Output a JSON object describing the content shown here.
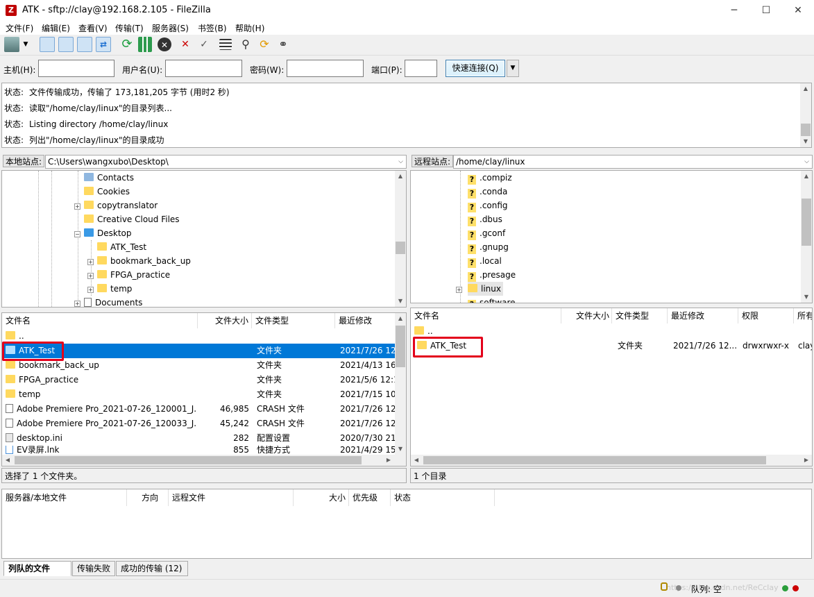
{
  "window": {
    "title": "ATK - sftp://clay@192.168.2.105 - FileZilla",
    "app_icon": "Z",
    "controls": [
      "─",
      "☐",
      "✕"
    ]
  },
  "menu": [
    "文件(F)",
    "编辑(E)",
    "查看(V)",
    "传输(T)",
    "服务器(S)",
    "书签(B)",
    "帮助(H)"
  ],
  "toolbar_icons": [
    "site-manager-icon",
    "dropdown-icon",
    "toggle-log-icon",
    "toggle-local-tree-icon",
    "toggle-remote-tree-icon",
    "toggle-queue-icon",
    "refresh-icon",
    "process-queue-icon",
    "cancel-icon",
    "disconnect-icon",
    "reconnect-icon",
    "filter-icon",
    "compare-icon",
    "sync-browse-icon",
    "search-icon"
  ],
  "quickconnect": {
    "host_label": "主机(H):",
    "user_label": "用户名(U):",
    "pass_label": "密码(W):",
    "port_label": "端口(P):",
    "host": "",
    "user": "",
    "pass": "",
    "port": "",
    "button": "快速连接(Q)",
    "dropdown": "▼"
  },
  "log": [
    {
      "k": "状态:",
      "v": "文件传输成功，传输了 173,181,205 字节 (用时2 秒)"
    },
    {
      "k": "状态:",
      "v": "读取\"/home/clay/linux\"的目录列表..."
    },
    {
      "k": "状态:",
      "v": "Listing directory /home/clay/linux"
    },
    {
      "k": "状态:",
      "v": "列出\"/home/clay/linux\"的目录成功"
    }
  ],
  "local": {
    "site_label": "本地站点:",
    "path": "C:\\Users\\wangxubo\\Desktop\\",
    "tree": [
      "Contacts",
      "Cookies",
      "copytranslator",
      "Creative Cloud Files",
      "Desktop",
      "ATK_Test",
      "bookmark_back_up",
      "FPGA_practice",
      "temp",
      "Documents"
    ],
    "headers": [
      "文件名",
      "文件大小",
      "文件类型",
      "最近修改"
    ],
    "files": [
      {
        "name": "..",
        "size": "",
        "type": "",
        "date": ""
      },
      {
        "name": "ATK_Test",
        "size": "",
        "type": "文件夹",
        "date": "2021/7/26 12"
      },
      {
        "name": "bookmark_back_up",
        "size": "",
        "type": "文件夹",
        "date": "2021/4/13 16"
      },
      {
        "name": "FPGA_practice",
        "size": "",
        "type": "文件夹",
        "date": "2021/5/6 12:1"
      },
      {
        "name": "temp",
        "size": "",
        "type": "文件夹",
        "date": "2021/7/15 10"
      },
      {
        "name": "Adobe Premiere Pro_2021-07-26_120001_J...",
        "size": "46,985",
        "type": "CRASH 文件",
        "date": "2021/7/26 12"
      },
      {
        "name": "Adobe Premiere Pro_2021-07-26_120033_J...",
        "size": "45,242",
        "type": "CRASH 文件",
        "date": "2021/7/26 12"
      },
      {
        "name": "desktop.ini",
        "size": "282",
        "type": "配置设置",
        "date": "2020/7/30 21"
      },
      {
        "name": "EV录屏.lnk",
        "size": "855",
        "type": "快捷方式",
        "date": "2021/4/29 15"
      }
    ],
    "status": "选择了 1 个文件夹。"
  },
  "remote": {
    "site_label": "远程站点:",
    "path": "/home/clay/linux",
    "tree": [
      ".compiz",
      ".conda",
      ".config",
      ".dbus",
      ".gconf",
      ".gnupg",
      ".local",
      ".presage",
      "linux",
      "software"
    ],
    "headers": [
      "文件名",
      "文件大小",
      "文件类型",
      "最近修改",
      "权限",
      "所有"
    ],
    "files": [
      {
        "name": "..",
        "size": "",
        "type": "",
        "date": "",
        "perm": "",
        "owner": ""
      },
      {
        "name": "ATK_Test",
        "size": "",
        "type": "文件夹",
        "date": "2021/7/26 12...",
        "perm": "drwxrwxr-x",
        "owner": "clay"
      }
    ],
    "status": "1 个目录"
  },
  "queue": {
    "headers": [
      "服务器/本地文件",
      "方向",
      "远程文件",
      "大小",
      "优先级",
      "状态"
    ]
  },
  "tabs": [
    "列队的文件",
    "传输失败",
    "成功的传输 (12)"
  ],
  "bottom": {
    "queue_label": "队列: 空",
    "watermark": "https://blog.csdn.net/ReCclay"
  },
  "colors": {
    "selection": "#0078d7",
    "highlight_box": "#e3001b",
    "folder": "#ffd95f"
  }
}
